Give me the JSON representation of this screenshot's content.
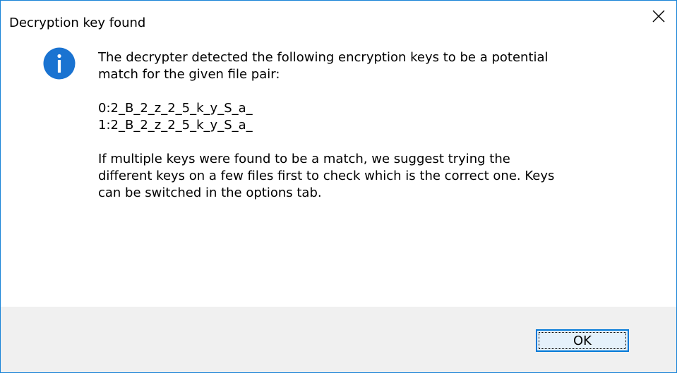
{
  "window": {
    "title": "Decryption key found",
    "close_icon": "close-icon"
  },
  "message": {
    "icon": "info-icon",
    "icon_color": "#1a73d1",
    "intro": "The decrypter detected the following encryption keys to be a potential\nmatch for the given file pair:",
    "keys": [
      "0:2_B_2_z_2_5_k_y_S_a_",
      "1:2_B_2_z_2_5_k_y_S_a_"
    ],
    "advice": "If multiple keys were found to be a match, we suggest trying the\ndifferent keys on a few files first to check which is the correct one. Keys\ncan be switched in the options tab."
  },
  "buttons": {
    "ok_label": "OK"
  },
  "colors": {
    "border": "#1883d7",
    "footer_bg": "#f0f0f0",
    "button_border": "#0078d7",
    "button_bg": "#e5f1fb"
  }
}
